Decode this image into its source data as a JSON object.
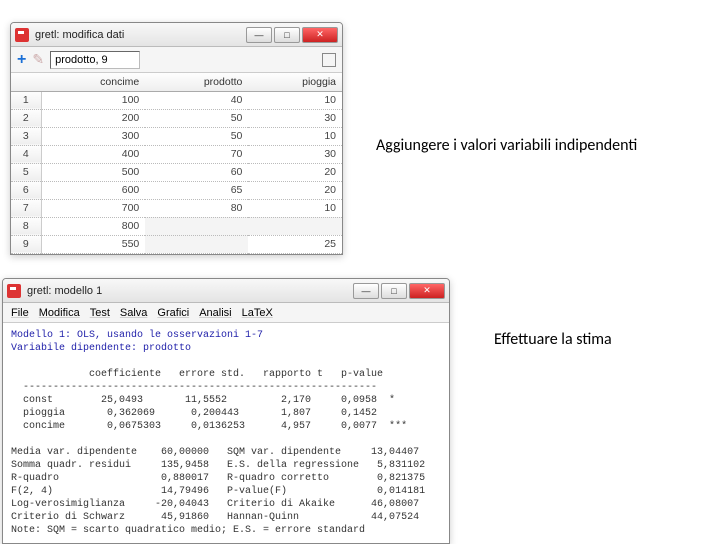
{
  "annotations": {
    "a1": "Aggiungere i valori variabili indipendenti",
    "a2": "Effettuare la stima"
  },
  "win1": {
    "title": "gretl: modifica dati",
    "input_value": "prodotto, 9",
    "cols": {
      "c1": "concime",
      "c2": "prodotto",
      "c3": "pioggia"
    },
    "rows": [
      {
        "n": "1",
        "concime": "100",
        "prodotto": "40",
        "pioggia": "10"
      },
      {
        "n": "2",
        "concime": "200",
        "prodotto": "50",
        "pioggia": "30"
      },
      {
        "n": "3",
        "concime": "300",
        "prodotto": "50",
        "pioggia": "10"
      },
      {
        "n": "4",
        "concime": "400",
        "prodotto": "70",
        "pioggia": "30"
      },
      {
        "n": "5",
        "concime": "500",
        "prodotto": "60",
        "pioggia": "20"
      },
      {
        "n": "6",
        "concime": "600",
        "prodotto": "65",
        "pioggia": "20"
      },
      {
        "n": "7",
        "concime": "700",
        "prodotto": "80",
        "pioggia": "10"
      },
      {
        "n": "8",
        "concime": "800",
        "prodotto": "",
        "pioggia": ""
      },
      {
        "n": "9",
        "concime": "550",
        "prodotto": "",
        "pioggia": "25"
      }
    ]
  },
  "win2": {
    "title": "gretl: modello 1",
    "menu": {
      "m1": "File",
      "m2": "Modifica",
      "m3": "Test",
      "m4": "Salva",
      "m5": "Grafici",
      "m6": "Analisi",
      "m7": "LaTeX"
    },
    "line_model": "Modello 1: OLS, usando le osservazioni 1-7",
    "line_depvar": "Variabile dipendente: prodotto",
    "hdr_coef": "             coefficiente   errore std.   rapporto t   p-value",
    "hdr_dash": "  -----------------------------------------------------------",
    "row_const": "  const        25,0493       11,5552         2,170     0,0958  *",
    "row_piog": "  pioggia       0,362069      0,200443       1,807     0,1452",
    "row_conc": "  concime       0,0675303     0,0136253      4,957     0,0077  ***",
    "s1": "Media var. dipendente    60,00000   SQM var. dipendente     13,04407",
    "s2": "Somma quadr. residui     135,9458   E.S. della regressione   5,831102",
    "s3": "R-quadro                 0,880017   R-quadro corretto        0,821375",
    "s4": "F(2, 4)                  14,79496   P-value(F)               0,014181",
    "s5": "Log-verosimiglianza     -20,04043   Criterio di Akaike      46,08007",
    "s6": "Criterio di Schwarz      45,91860   Hannan-Quinn            44,07524",
    "note": "Note: SQM = scarto quadratico medio; E.S. = errore standard"
  }
}
